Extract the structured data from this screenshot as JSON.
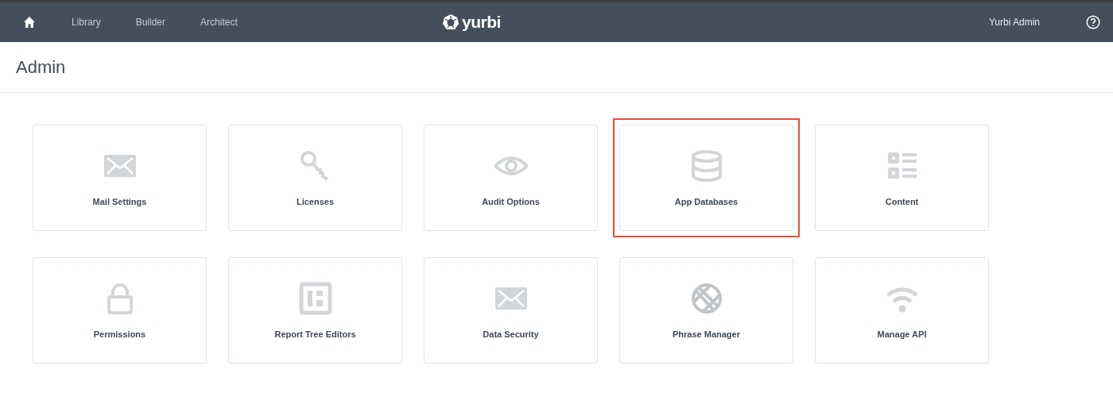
{
  "navbar": {
    "logo": "yurbi",
    "links": [
      {
        "label": "Library"
      },
      {
        "label": "Builder"
      },
      {
        "label": "Architect"
      }
    ],
    "user": "Yurbi Admin"
  },
  "page_title": "Admin",
  "tiles": [
    {
      "label": "Mail Settings",
      "kind": "mail",
      "highlighted": false
    },
    {
      "label": "Licenses",
      "kind": "key",
      "highlighted": false
    },
    {
      "label": "Audit Options",
      "kind": "eye",
      "highlighted": false
    },
    {
      "label": "App Databases",
      "kind": "database",
      "highlighted": true
    },
    {
      "label": "Content",
      "kind": "list",
      "highlighted": false
    },
    {
      "label": "Permissions",
      "kind": "lock",
      "highlighted": false
    },
    {
      "label": "Report Tree Editors",
      "kind": "board",
      "highlighted": false
    },
    {
      "label": "Data Security",
      "kind": "mail",
      "highlighted": false
    },
    {
      "label": "Phrase Manager",
      "kind": "globe",
      "highlighted": false
    },
    {
      "label": "Manage API",
      "kind": "wifi",
      "highlighted": false
    }
  ]
}
